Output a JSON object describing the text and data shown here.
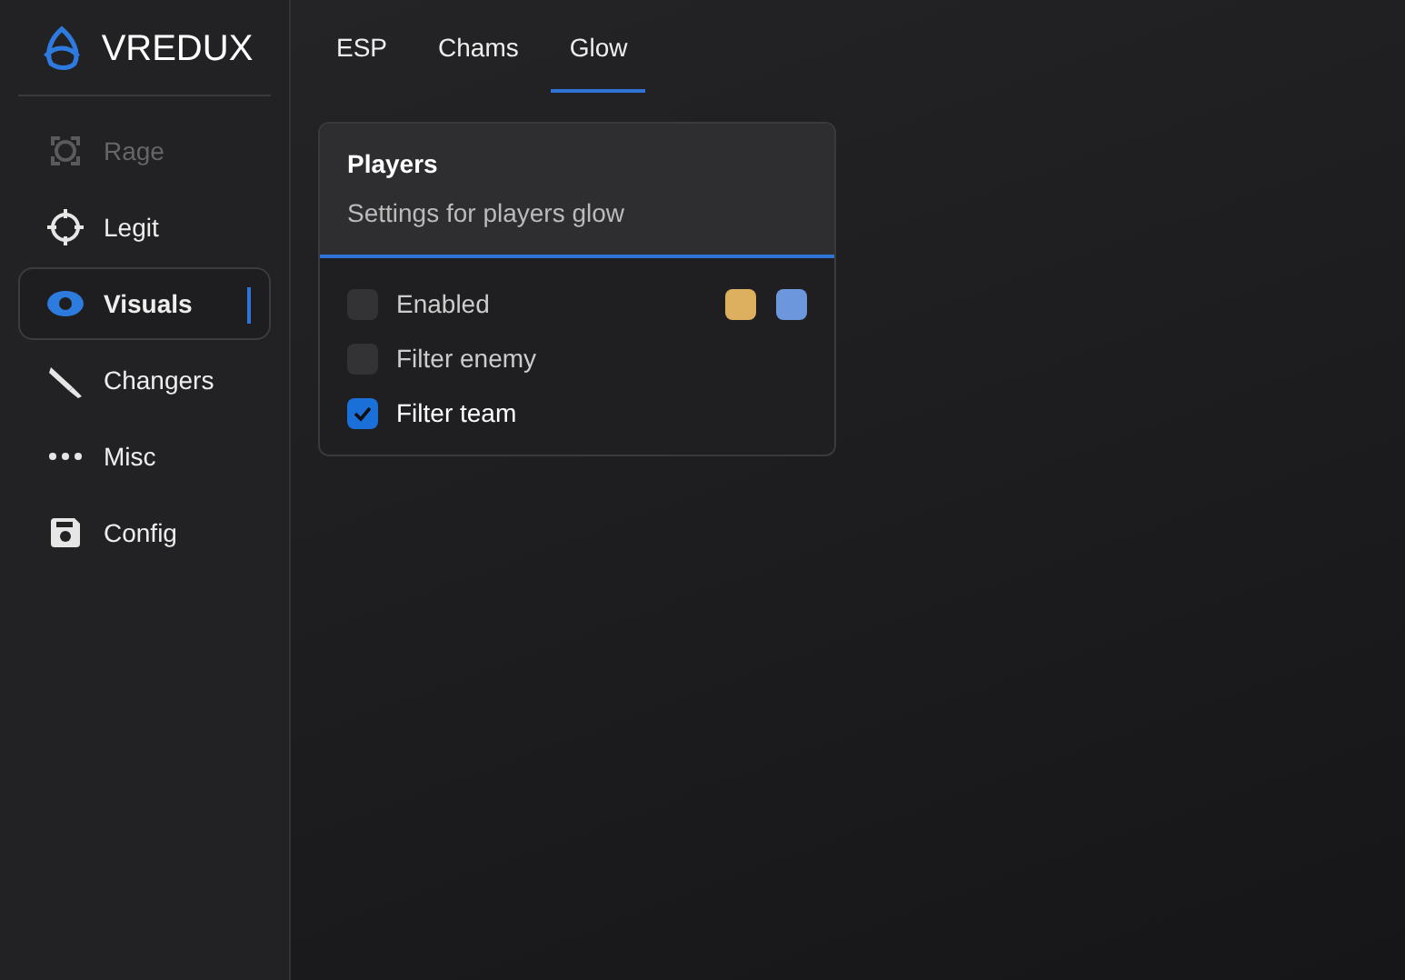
{
  "logo": {
    "text": "VREDUX"
  },
  "sidebar": {
    "items": [
      {
        "label": "Rage",
        "selected": false,
        "disabled": true
      },
      {
        "label": "Legit",
        "selected": false,
        "disabled": false
      },
      {
        "label": "Visuals",
        "selected": true,
        "disabled": false
      },
      {
        "label": "Changers",
        "selected": false,
        "disabled": false
      },
      {
        "label": "Misc",
        "selected": false,
        "disabled": false
      },
      {
        "label": "Config",
        "selected": false,
        "disabled": false
      }
    ]
  },
  "tabs": [
    {
      "label": "ESP",
      "selected": false
    },
    {
      "label": "Chams",
      "selected": false
    },
    {
      "label": "Glow",
      "selected": true
    }
  ],
  "panel": {
    "title": "Players",
    "subtitle": "Settings for players glow",
    "options": [
      {
        "label": "Enabled",
        "checked": false,
        "swatches": [
          {
            "color": "#dcb05f"
          },
          {
            "color": "#6c97dc"
          }
        ]
      },
      {
        "label": "Filter enemy",
        "checked": false
      },
      {
        "label": "Filter team",
        "checked": true
      }
    ]
  }
}
